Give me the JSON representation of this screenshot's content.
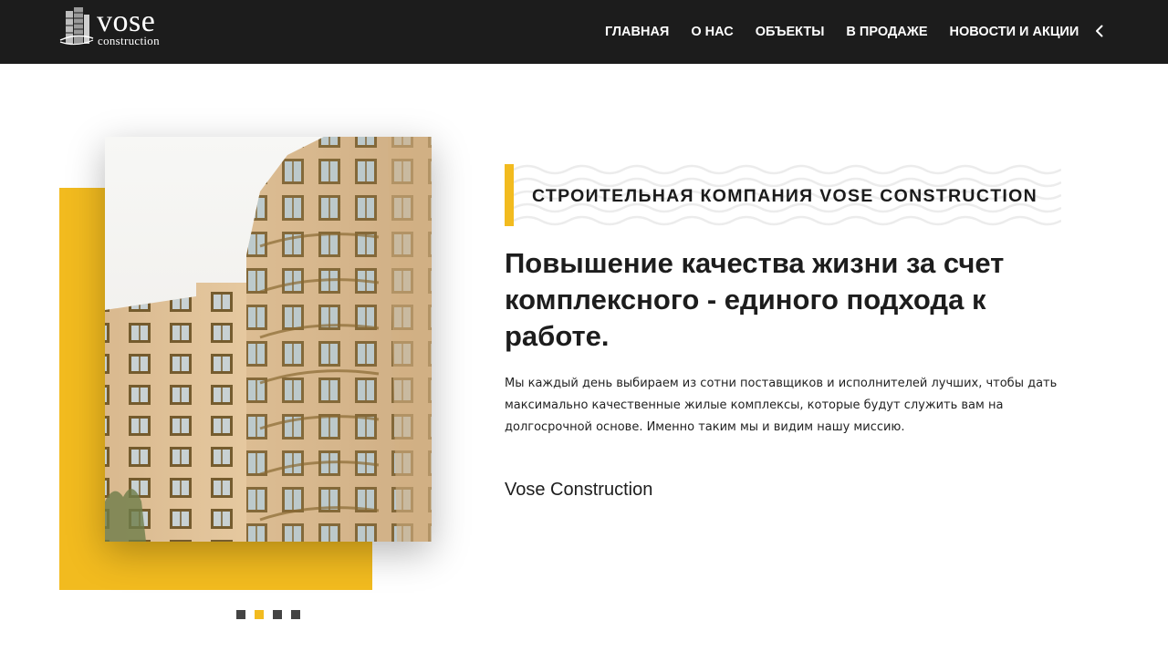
{
  "header": {
    "logo": {
      "word": "vose",
      "sub": "construction"
    },
    "nav": [
      {
        "label": "ГЛАВНАЯ"
      },
      {
        "label": "О НАС"
      },
      {
        "label": "ОБЪЕКТЫ"
      },
      {
        "label": "В ПРОДАЖЕ"
      },
      {
        "label": "НОВОСТИ И АКЦИИ"
      }
    ],
    "collapse_icon": "chevron-left-icon"
  },
  "hero": {
    "eyebrow": "СТРОИТЕЛЬНАЯ КОМПАНИЯ VOSE CONSTRUCTION",
    "headline": "Повышение качества жизни за счет комплексного - единого подхода к работе.",
    "body": "Мы каждый день выбираем из сотни поставщиков и исполнителей лучших, чтобы дать максимально качественные жилые комплексы, которые будут служить вам на долгосрочной основе. Именно таким мы и видим нашу миссию.",
    "signature": "Vose Construction",
    "image": "building-photo",
    "slider": {
      "count": 4,
      "active_index": 1
    }
  },
  "colors": {
    "header_bg": "#1c1c1c",
    "accent": "#f2bb1f",
    "text": "#1d1d1d"
  }
}
